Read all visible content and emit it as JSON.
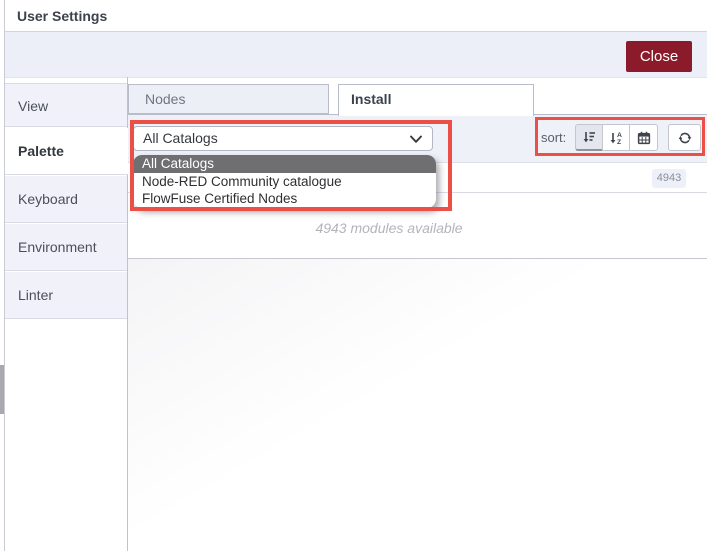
{
  "window": {
    "title": "User Settings",
    "close_label": "Close"
  },
  "sidebar": {
    "items": [
      {
        "label": "View",
        "active": false
      },
      {
        "label": "Palette",
        "active": true
      },
      {
        "label": "Keyboard",
        "active": false
      },
      {
        "label": "Environment",
        "active": false
      },
      {
        "label": "Linter",
        "active": false
      }
    ]
  },
  "tabs": {
    "items": [
      {
        "label": "Nodes",
        "active": false
      },
      {
        "label": "Install",
        "active": true
      }
    ]
  },
  "toolbar": {
    "catalog_value": "All Catalogs",
    "sort_label": "sort:",
    "sort_buttons": [
      {
        "icon": "sort-amount-desc-icon",
        "selected": true
      },
      {
        "icon": "sort-alpha-icon",
        "selected": false
      },
      {
        "icon": "calendar-icon",
        "selected": false
      }
    ],
    "refresh_icon": "refresh-icon"
  },
  "catalog_dropdown": {
    "options": [
      "All Catalogs",
      "Node-RED Community catalogue",
      "FlowFuse Certified Nodes"
    ],
    "highlighted_option": "All Catalogs"
  },
  "install_panel": {
    "module_count_badge": "4943",
    "modules_available_text": "4943 modules available"
  },
  "colors": {
    "close_button_bg": "#8b1b2b",
    "annotation_red": "#ec4f46",
    "dropdown_highlight_bg": "#6f6f72",
    "toolbar_bg": "#eff1f8"
  }
}
